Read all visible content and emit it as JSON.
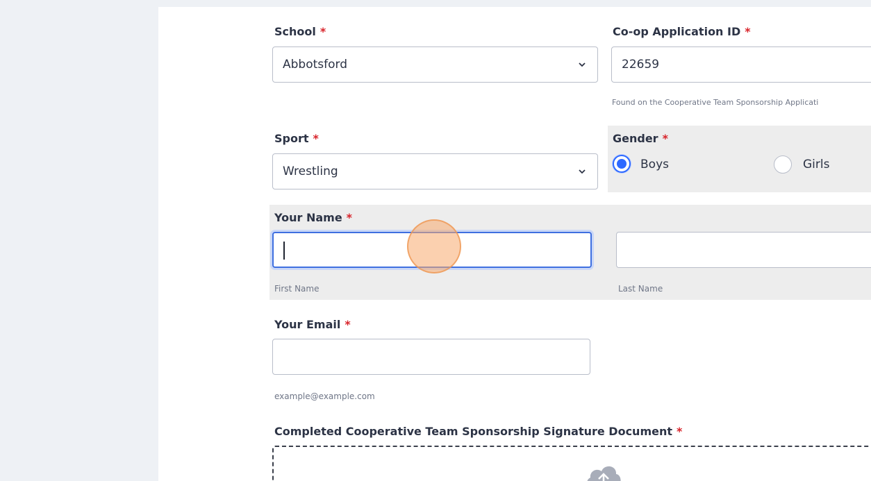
{
  "form": {
    "school": {
      "label": "School",
      "required": "*",
      "value": "Abbotsford"
    },
    "coop_id": {
      "label": "Co-op Application ID",
      "required": "*",
      "value": "22659",
      "help": "Found on the Cooperative Team Sponsorship Applicati"
    },
    "sport": {
      "label": "Sport",
      "required": "*",
      "value": "Wrestling"
    },
    "gender": {
      "label": "Gender",
      "required": "*",
      "options": [
        {
          "label": "Boys",
          "checked": true
        },
        {
          "label": "Girls",
          "checked": false
        }
      ]
    },
    "name": {
      "label": "Your Name",
      "required": "*",
      "first_value": "",
      "last_value": "",
      "first_sub": "First Name",
      "last_sub": "Last Name"
    },
    "email": {
      "label": "Your Email",
      "required": "*",
      "value": "",
      "help": "example@example.com"
    },
    "upload": {
      "label": "Completed Cooperative Team Sponsorship Signature Document",
      "required": "*",
      "icon": "cloud-upload-icon"
    }
  },
  "colors": {
    "accent": "#2e69ff",
    "required": "#d8232a",
    "shade": "#ededed",
    "click_indicator": "#f7aa6e"
  }
}
